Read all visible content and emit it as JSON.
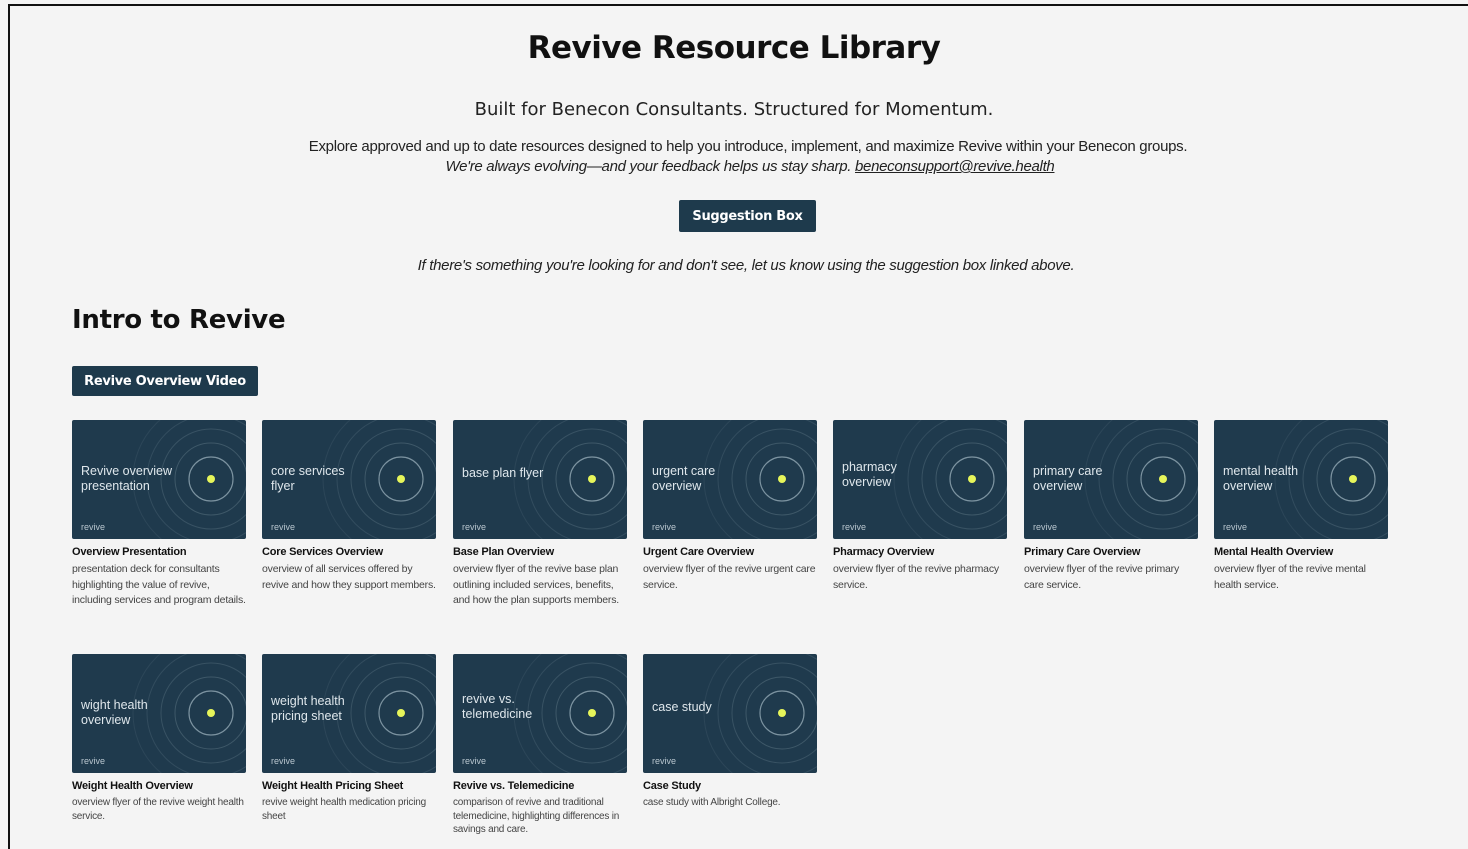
{
  "header": {
    "title": "Revive Resource Library",
    "subtitle": "Built for Benecon Consultants. Structured for Momentum.",
    "intro_line1": "Explore approved and up to date resources designed to help you introduce, implement, and maximize Revive within your Benecon groups.",
    "intro_line2_text": "We're always evolving—and your feedback helps us stay sharp. ",
    "support_email": "beneconsupport@revive.health",
    "suggestion_button": "Suggestion Box",
    "note": "If there's something you're looking for and don't see, let us know using the suggestion box linked above."
  },
  "section": {
    "title": "Intro to Revive",
    "video_button": "Revive Overview Video"
  },
  "thumb_logo": "revive",
  "colors": {
    "card_bg": "#1f3a4d",
    "accent_dot": "#e6f55a",
    "button_bg": "#1e3a4c"
  },
  "cards": [
    {
      "thumb_label": "Revive overview presentation",
      "title": "Overview Presentation",
      "desc": "presentation deck for consultants highlighting the value of revive, including services and program details."
    },
    {
      "thumb_label": "core services flyer",
      "title": "Core Services Overview",
      "desc": "overview of all services offered by revive and how they support members."
    },
    {
      "thumb_label": "base plan flyer",
      "title": "Base Plan Overview",
      "desc": "overview flyer of the revive base plan outlining included services, benefits, and how the plan supports members."
    },
    {
      "thumb_label": "urgent care overview",
      "title": "Urgent Care Overview",
      "desc": "overview flyer of the revive urgent care service."
    },
    {
      "thumb_label": "pharmacy overview",
      "title": "Pharmacy Overview",
      "desc": "overview flyer of the revive pharmacy service."
    },
    {
      "thumb_label": "primary care overview",
      "title": "Primary Care Overview",
      "desc": "overview flyer of the revive primary care service."
    },
    {
      "thumb_label": "mental health overview",
      "title": "Mental Health Overview",
      "desc": "overview flyer of the revive mental health service."
    },
    {
      "thumb_label": "wight health overview",
      "title": "Weight Health Overview",
      "desc": "overview flyer of the revive weight health service."
    },
    {
      "thumb_label": "weight health pricing sheet",
      "title": "Weight Health Pricing Sheet",
      "desc": "revive weight health medication pricing sheet"
    },
    {
      "thumb_label": "revive vs. telemedicine",
      "title": "Revive vs. Telemedicine",
      "desc": "comparison of revive and traditional telemedicine, highlighting differences in savings and care."
    },
    {
      "thumb_label": "case study",
      "title": "Case Study",
      "desc": "case study with Albright College."
    }
  ]
}
